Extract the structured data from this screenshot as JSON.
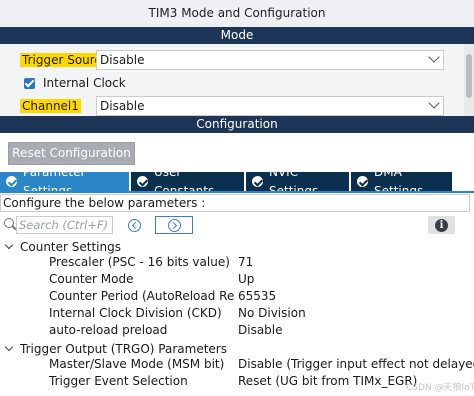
{
  "window": {
    "title": "TIM3 Mode and Configuration"
  },
  "mode_section": {
    "header": "Mode",
    "trigger_source": {
      "label": "Trigger Source",
      "value": "Disable"
    },
    "internal_clock": {
      "label": "Internal Clock",
      "checked": true
    },
    "channel1": {
      "label": "Channel1",
      "value": "Disable"
    }
  },
  "config_section": {
    "header": "Configuration",
    "reset_button": "Reset Configuration",
    "tabs": [
      {
        "label": "Parameter Settings",
        "active": true
      },
      {
        "label": "User Constants",
        "active": false
      },
      {
        "label": "NVIC Settings",
        "active": false
      },
      {
        "label": "DMA Settings",
        "active": false
      }
    ],
    "instruction": "Configure the below parameters :",
    "search": {
      "placeholder": "Search (Ctrl+F)"
    },
    "groups": [
      {
        "name": "Counter Settings",
        "params": [
          {
            "name": "Prescaler (PSC - 16 bits value)",
            "value": "71"
          },
          {
            "name": "Counter Mode",
            "value": "Up"
          },
          {
            "name": "Counter Period (AutoReload Registe...",
            "value": "65535"
          },
          {
            "name": "Internal Clock Division (CKD)",
            "value": "No Division"
          },
          {
            "name": "auto-reload preload",
            "value": "Disable"
          }
        ]
      },
      {
        "name": "Trigger Output (TRGO) Parameters",
        "params": [
          {
            "name": "Master/Slave Mode (MSM bit)",
            "value": "Disable (Trigger input effect not delayed)"
          },
          {
            "name": "Trigger Event Selection",
            "value": "Reset (UG bit from TIMx_EGR)"
          }
        ]
      }
    ]
  },
  "watermark": "CSDN @天狼IoT",
  "colors": {
    "header_bg": "#1d3557",
    "tab_bg": "#0b2f4e",
    "tab_active": "#2b86c8",
    "highlight": "#ffd800",
    "button_bg": "#a9adb3"
  },
  "icons": [
    "search-icon",
    "prev-arrow-icon",
    "next-arrow-icon",
    "info-icon",
    "check-icon",
    "chevron-down-icon",
    "expand-caret-icon"
  ]
}
